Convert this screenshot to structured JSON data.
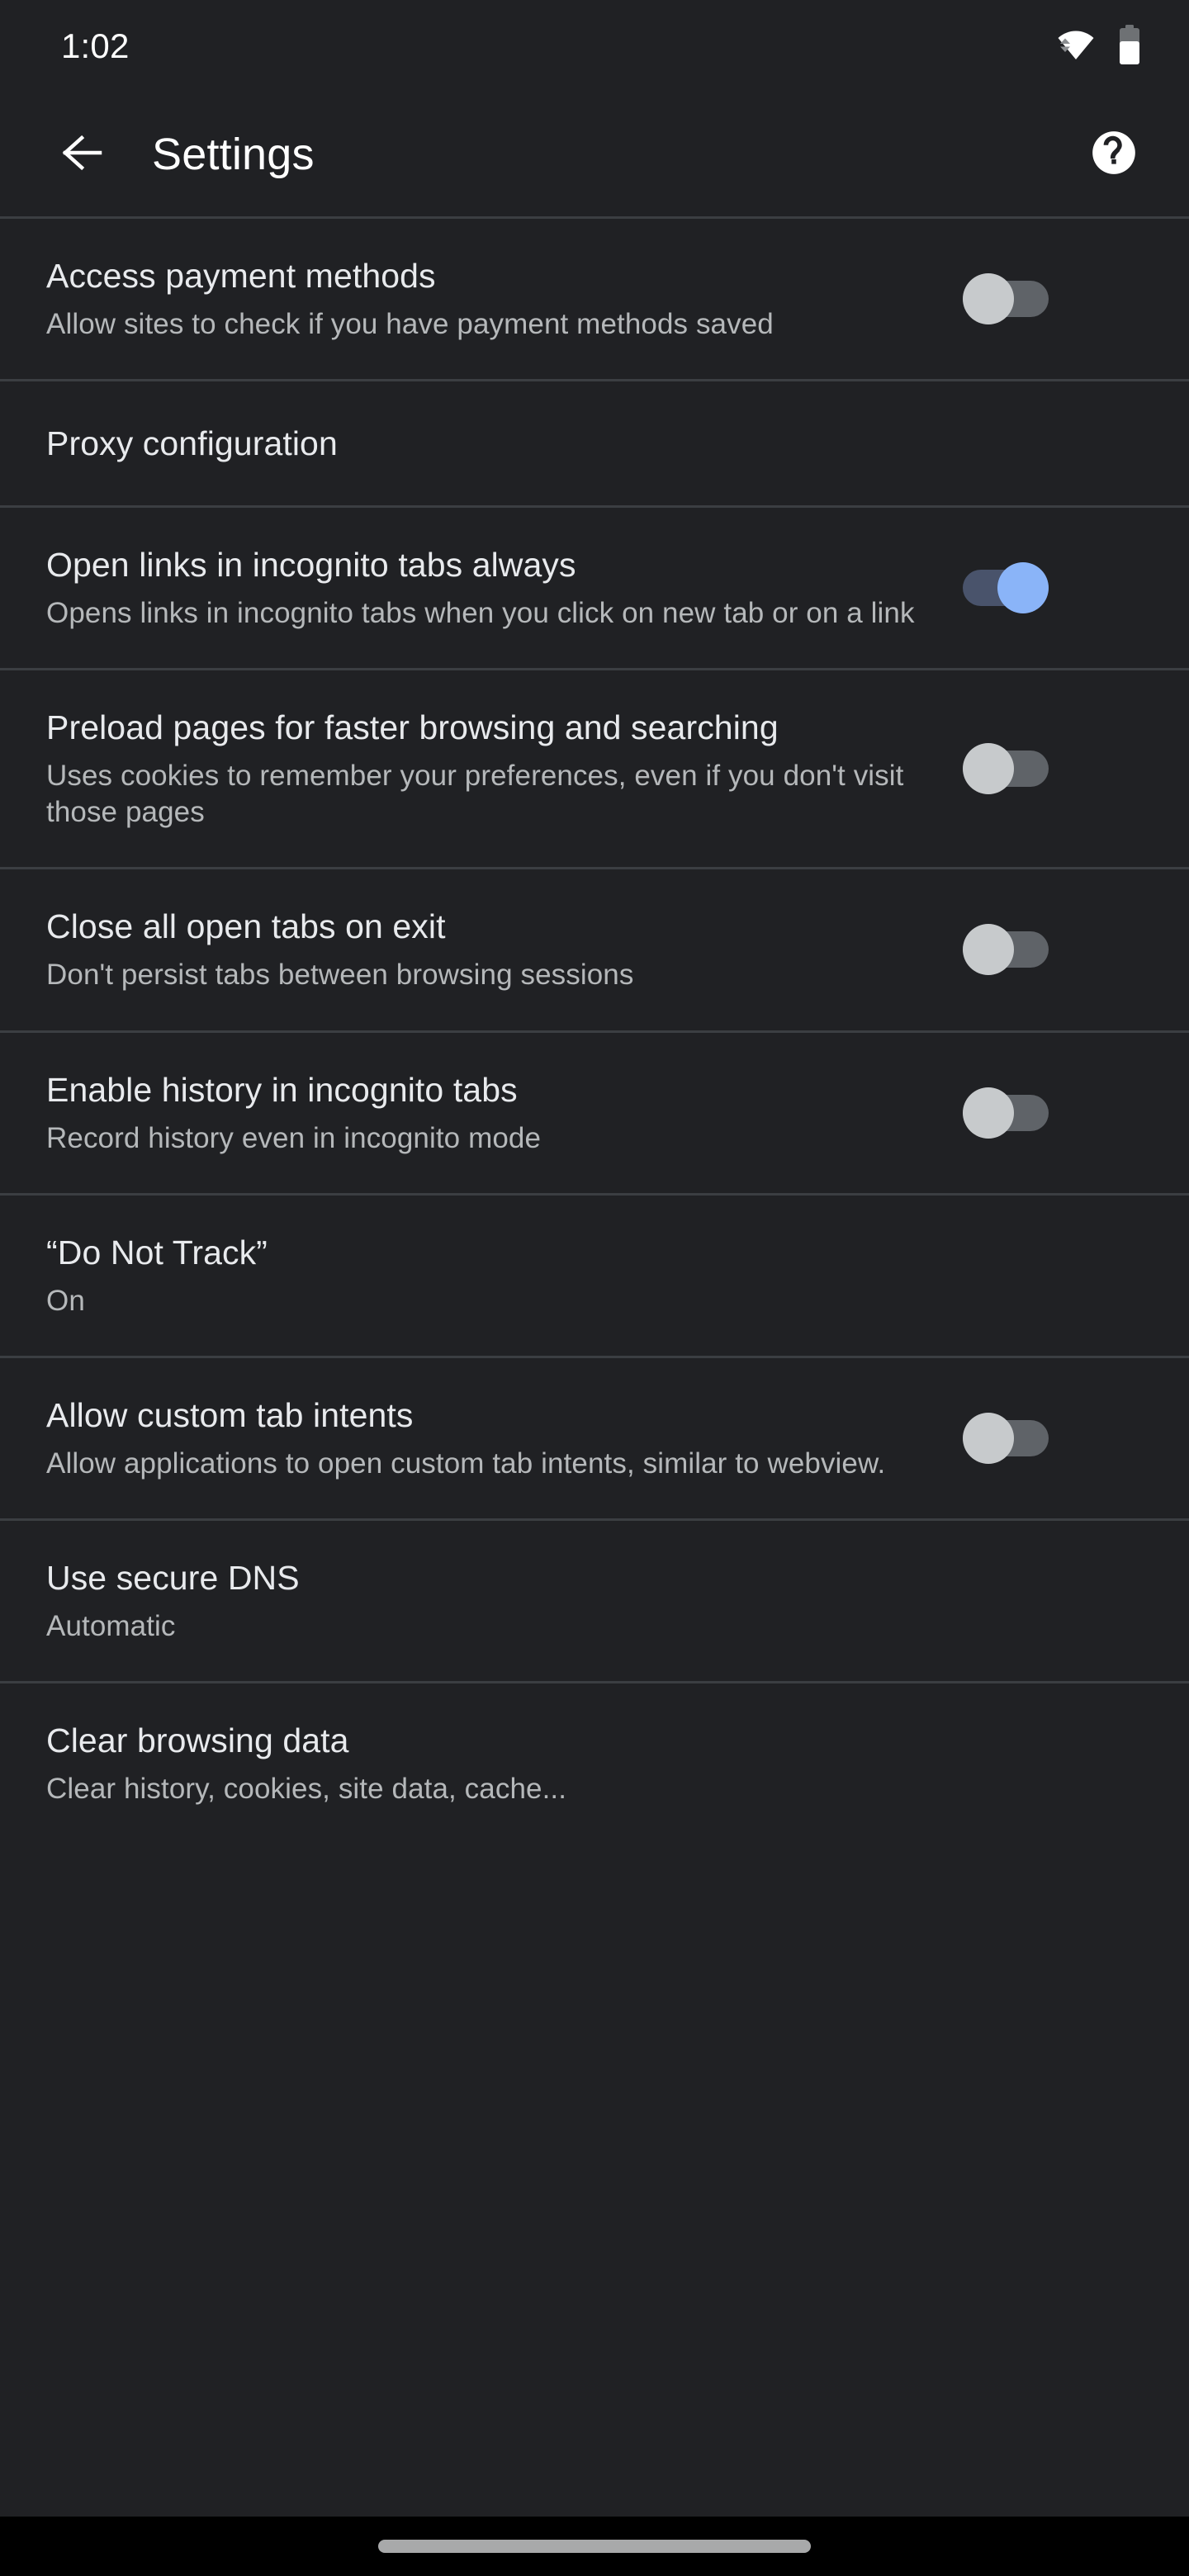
{
  "status_bar": {
    "time": "1:02",
    "wifi_icon": "wifi-icon",
    "battery_icon": "battery-icon",
    "battery_level_percent": 62
  },
  "app_bar": {
    "back_icon": "back-arrow-icon",
    "title": "Settings",
    "help_icon": "help-circle-icon"
  },
  "colors": {
    "background": "#202124",
    "divider": "#3b3e42",
    "title_text": "#e8eaed",
    "subtitle_text": "#b5b8ba",
    "toggle_on_thumb": "#8ab4f8",
    "toggle_on_track": "#49536b",
    "toggle_off_thumb": "#c7cacc",
    "toggle_off_track": "#5f6368",
    "nav_bar": "#000000",
    "nav_pill": "#a8a9aa"
  },
  "settings": {
    "items": [
      {
        "title": "Access payment methods",
        "subtitle": "Allow sites to check if you have payment methods saved",
        "control": "toggle",
        "value": "off"
      },
      {
        "title": "Proxy configuration",
        "subtitle": "",
        "control": "none",
        "value": ""
      },
      {
        "title": "Open links in incognito tabs always",
        "subtitle": "Opens links in incognito tabs when you click on new tab or on a link",
        "control": "toggle",
        "value": "on"
      },
      {
        "title": "Preload pages for faster browsing and searching",
        "subtitle": "Uses cookies to remember your preferences, even if you don't visit those pages",
        "control": "toggle",
        "value": "off"
      },
      {
        "title": "Close all open tabs on exit",
        "subtitle": "Don't persist tabs between browsing sessions",
        "control": "toggle",
        "value": "off"
      },
      {
        "title": "Enable history in incognito tabs",
        "subtitle": "Record history even in incognito mode",
        "control": "toggle",
        "value": "off"
      },
      {
        "title": "“Do Not Track”",
        "subtitle": "On",
        "control": "none",
        "value": ""
      },
      {
        "title": "Allow custom tab intents",
        "subtitle": "Allow applications to open custom tab intents, similar to webview.",
        "control": "toggle",
        "value": "off"
      },
      {
        "title": "Use secure DNS",
        "subtitle": "Automatic",
        "control": "none",
        "value": ""
      },
      {
        "title": "Clear browsing data",
        "subtitle": "Clear history, cookies, site data, cache...",
        "control": "none",
        "value": ""
      }
    ]
  },
  "nav_bar": {
    "home_pill": "home-gesture-pill"
  }
}
